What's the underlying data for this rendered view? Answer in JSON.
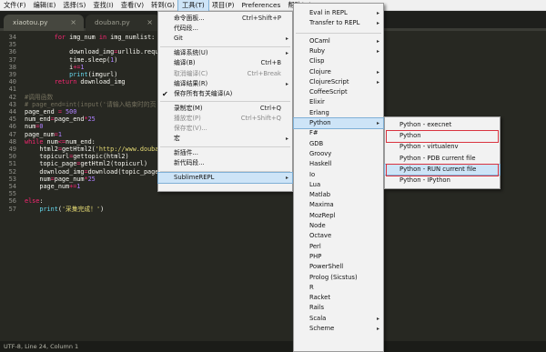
{
  "menubar": {
    "items": [
      "文件(F)",
      "编辑(E)",
      "选择(S)",
      "查找(I)",
      "查看(V)",
      "转到(G)",
      "工具(T)",
      "项目(P)",
      "Preferences",
      "帮助(H)"
    ],
    "open_item": "工具(T)"
  },
  "tabs": [
    {
      "name": "xiaotou.py",
      "active": true
    },
    {
      "name": "douban.py",
      "active": false
    }
  ],
  "tab_close_glyph": "×",
  "editor": {
    "line_numbers": [
      "34",
      "35",
      "36",
      "37",
      "38",
      "39",
      "40",
      "41",
      "42",
      "43",
      "44",
      "45",
      "46",
      "47",
      "48",
      "49",
      "50",
      "51",
      "52",
      "53",
      "54",
      "55",
      "56",
      "57"
    ],
    "lines": [
      [
        {
          "t": "        "
        },
        {
          "t": "for",
          "c": "kw"
        },
        {
          "t": " img_num "
        },
        {
          "t": "in",
          "c": "kw"
        },
        {
          "t": " img_numlist:"
        }
      ],
      [
        {
          "t": ""
        }
      ],
      [
        {
          "t": "            download_img"
        },
        {
          "t": "=",
          "c": "kw"
        },
        {
          "t": "urllib.request"
        }
      ],
      [
        {
          "t": "            time.sleep("
        },
        {
          "t": "1",
          "c": "nm"
        },
        {
          "t": ")"
        }
      ],
      [
        {
          "t": "            i"
        },
        {
          "t": "+=",
          "c": "kw"
        },
        {
          "t": "1",
          "c": "nm"
        }
      ],
      [
        {
          "t": "            "
        },
        {
          "t": "print",
          "c": "fn"
        },
        {
          "t": "(imgurl)"
        }
      ],
      [
        {
          "t": "        "
        },
        {
          "t": "return",
          "c": "kw"
        },
        {
          "t": " download_img"
        }
      ],
      [
        {
          "t": ""
        }
      ],
      [
        {
          "t": "#调用函数",
          "c": "cm"
        }
      ],
      [
        {
          "t": "# page_end=int(input('请输入结束时的页",
          "c": "cm"
        }
      ],
      [
        {
          "t": "page_end "
        },
        {
          "t": "=",
          "c": "kw"
        },
        {
          "t": " "
        },
        {
          "t": "500",
          "c": "nm"
        }
      ],
      [
        {
          "t": "num_end"
        },
        {
          "t": "=",
          "c": "kw"
        },
        {
          "t": "page_end"
        },
        {
          "t": "*",
          "c": "kw"
        },
        {
          "t": "25",
          "c": "nm"
        }
      ],
      [
        {
          "t": "num"
        },
        {
          "t": "=",
          "c": "kw"
        },
        {
          "t": "0",
          "c": "nm"
        }
      ],
      [
        {
          "t": "page_num"
        },
        {
          "t": "=",
          "c": "kw"
        },
        {
          "t": "1",
          "c": "nm"
        }
      ],
      [
        {
          "t": "while",
          "c": "kw"
        },
        {
          "t": " num"
        },
        {
          "t": "<=",
          "c": "kw"
        },
        {
          "t": "num_end:"
        }
      ],
      [
        {
          "t": "    html2"
        },
        {
          "t": "=",
          "c": "kw"
        },
        {
          "t": "getHtml2("
        },
        {
          "t": "'http://www.douban.c",
          "c": "st"
        }
      ],
      [
        {
          "t": "    topicurl"
        },
        {
          "t": "=",
          "c": "kw"
        },
        {
          "t": "gettopic(html2)"
        }
      ],
      [
        {
          "t": "    topic_page"
        },
        {
          "t": "=",
          "c": "kw"
        },
        {
          "t": "getHtml2(topicurl)"
        }
      ],
      [
        {
          "t": "    download_img"
        },
        {
          "t": "=",
          "c": "kw"
        },
        {
          "t": "download(topic_page)"
        }
      ],
      [
        {
          "t": "    num"
        },
        {
          "t": "=",
          "c": "kw"
        },
        {
          "t": "page_num"
        },
        {
          "t": "*",
          "c": "kw"
        },
        {
          "t": "25",
          "c": "nm"
        }
      ],
      [
        {
          "t": "    page_num"
        },
        {
          "t": "+=",
          "c": "kw"
        },
        {
          "t": "1",
          "c": "nm"
        }
      ],
      [
        {
          "t": ""
        }
      ],
      [
        {
          "t": "else",
          "c": "kw"
        },
        {
          "t": ":"
        }
      ],
      [
        {
          "t": "    "
        },
        {
          "t": "print",
          "c": "fn"
        },
        {
          "t": "("
        },
        {
          "t": "'采集完成！'",
          "c": "st"
        },
        {
          "t": ")"
        }
      ]
    ]
  },
  "tools_menu": [
    {
      "label": "命令面板...",
      "shortcut": "Ctrl+Shift+P"
    },
    {
      "label": "代码段..."
    },
    {
      "label": "Git",
      "submenu": true
    },
    {
      "sep": true
    },
    {
      "label": "编译系统(U)",
      "submenu": true
    },
    {
      "label": "编译(B)",
      "shortcut": "Ctrl+B"
    },
    {
      "label": "取消编译(C)",
      "shortcut": "Ctrl+Break",
      "disabled": true
    },
    {
      "label": "编译结果(R)",
      "submenu": true
    },
    {
      "label": "保存所有有关编译(A)",
      "checked": true
    },
    {
      "sep": true
    },
    {
      "label": "录制宏(M)",
      "shortcut": "Ctrl+Q"
    },
    {
      "label": "播放宏(P)",
      "shortcut": "Ctrl+Shift+Q",
      "disabled": true
    },
    {
      "label": "保存宏(V)...",
      "disabled": true
    },
    {
      "label": "宏",
      "submenu": true
    },
    {
      "sep": true
    },
    {
      "label": "新插件..."
    },
    {
      "label": "新代码段..."
    },
    {
      "sep": true
    },
    {
      "label": "SublimeREPL",
      "submenu": true,
      "highlighted": true
    }
  ],
  "repl_menu": [
    {
      "label": "Eval in REPL",
      "submenu": true
    },
    {
      "label": "Transfer to REPL",
      "submenu": true
    },
    {
      "sep": true
    },
    {
      "label": "OCaml",
      "submenu": true
    },
    {
      "label": "Ruby",
      "submenu": true
    },
    {
      "label": "Clisp"
    },
    {
      "label": "Clojure",
      "submenu": true
    },
    {
      "label": "ClojureScript",
      "submenu": true
    },
    {
      "label": "CoffeeScript"
    },
    {
      "label": "Elixir"
    },
    {
      "label": "Erlang"
    },
    {
      "label": "Python",
      "submenu": true,
      "highlighted": true
    },
    {
      "label": "F#"
    },
    {
      "label": "GDB"
    },
    {
      "label": "Groovy"
    },
    {
      "label": "Haskell"
    },
    {
      "label": "Io"
    },
    {
      "label": "Lua"
    },
    {
      "label": "Matlab"
    },
    {
      "label": "Maxima"
    },
    {
      "label": "MozRepl"
    },
    {
      "label": "Node"
    },
    {
      "label": "Octave"
    },
    {
      "label": "Perl"
    },
    {
      "label": "PHP"
    },
    {
      "label": "PowerShell"
    },
    {
      "label": "Prolog (Sicstus)"
    },
    {
      "label": "R"
    },
    {
      "label": "Racket"
    },
    {
      "label": "Rails"
    },
    {
      "label": "Scala",
      "submenu": true
    },
    {
      "label": "Scheme",
      "submenu": true
    }
  ],
  "python_menu": [
    {
      "label": "Python - execnet"
    },
    {
      "label": "Python",
      "boxed": true
    },
    {
      "label": "Python - virtualenv"
    },
    {
      "label": "Python - PDB current file"
    },
    {
      "label": "Python - RUN current file",
      "boxed": true,
      "highlighted": true
    },
    {
      "label": "Python - IPython"
    }
  ],
  "glyphs": {
    "submenu_arrow": "▸",
    "check": "✔"
  },
  "statusbar": {
    "text": "UTF-8, Line 24, Column 1"
  },
  "colors": {
    "editor_bg": "#272822",
    "keyword": "#f92672",
    "string": "#e6db74",
    "number": "#ae81ff",
    "builtin": "#66d9ef",
    "comment": "#75715e",
    "highlight": "#cde4f7",
    "red_box": "#d9333f"
  }
}
